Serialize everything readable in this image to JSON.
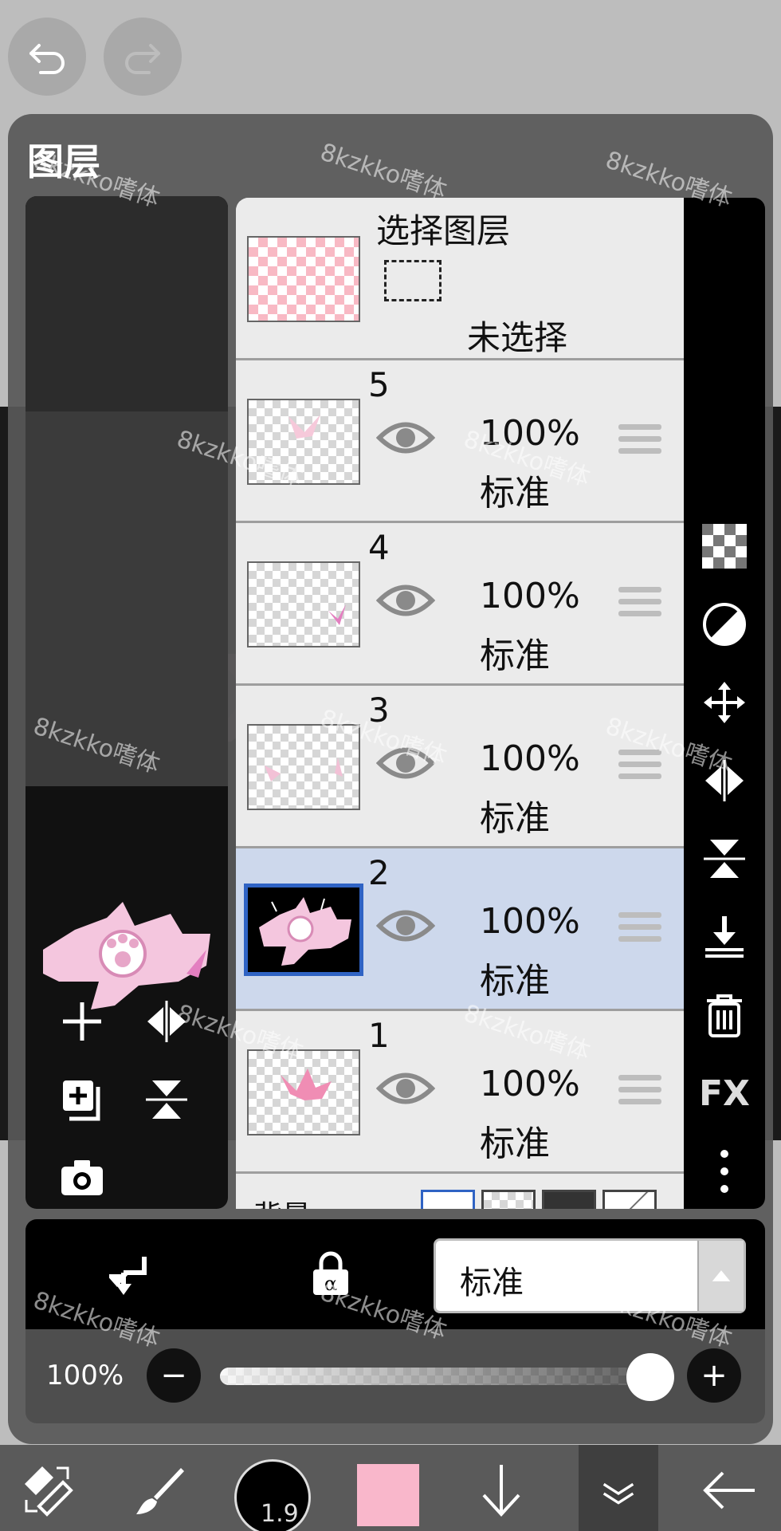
{
  "panel": {
    "title": "图层"
  },
  "selection_layer": {
    "title": "选择图层",
    "status": "未选择"
  },
  "layers": [
    {
      "number": "5",
      "opacity": "100%",
      "mode": "标准"
    },
    {
      "number": "4",
      "opacity": "100%",
      "mode": "标准"
    },
    {
      "number": "3",
      "opacity": "100%",
      "mode": "标准"
    },
    {
      "number": "2",
      "opacity": "100%",
      "mode": "标准",
      "selected": true
    },
    {
      "number": "1",
      "opacity": "100%",
      "mode": "标准"
    }
  ],
  "background_layer": {
    "label": "背景"
  },
  "right_toolbar": {
    "fx_label": "FX"
  },
  "blend": {
    "mode_value": "标准"
  },
  "opacity": {
    "label": "100%",
    "minus": "−",
    "plus": "+",
    "value": 100
  },
  "bottom_bar": {
    "brush_size": "1.9",
    "color": "#f9b7cb"
  },
  "watermark": "8kzkko嗜体",
  "colors": {
    "accent_selected_row": "#cdd8ec",
    "selected_border": "#2f63c4",
    "panel_bg": "#585858"
  }
}
